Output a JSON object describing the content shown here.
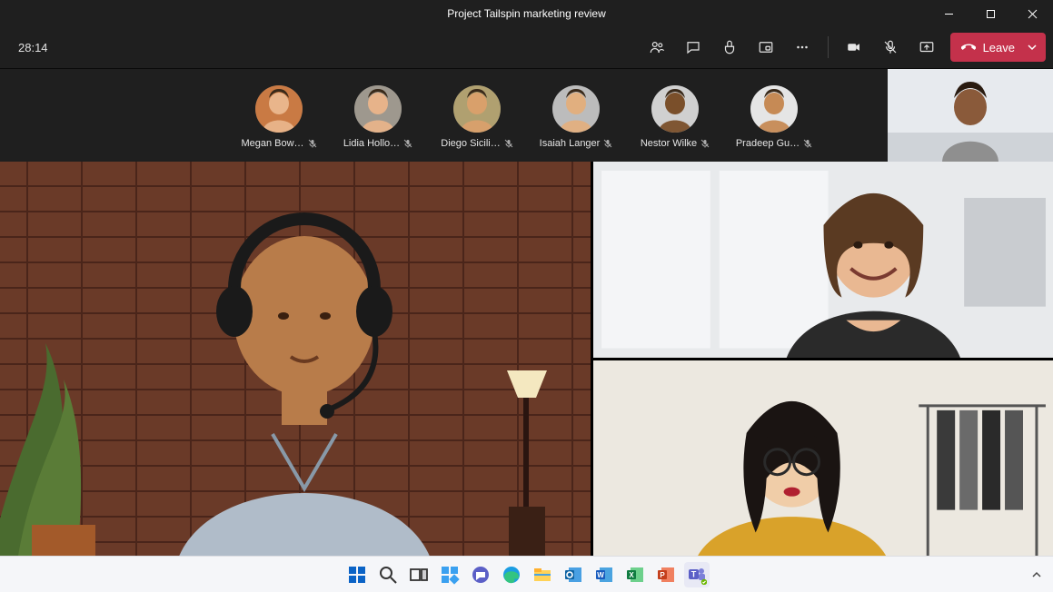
{
  "window": {
    "title": "Project Tailspin marketing review"
  },
  "meeting": {
    "elapsed": "28:14",
    "leave_label": "Leave"
  },
  "roster": {
    "items": [
      {
        "name": "Megan Bow…",
        "muted": true,
        "bg": "#c97a44",
        "skin": "#e9b58b"
      },
      {
        "name": "Lidia Hollo…",
        "muted": true,
        "bg": "#9e988e",
        "skin": "#e7b38a"
      },
      {
        "name": "Diego Sicili…",
        "muted": true,
        "bg": "#b0a070",
        "skin": "#d9a06b"
      },
      {
        "name": "Isaiah Langer",
        "muted": true,
        "bg": "#bcbcbc",
        "skin": "#e1af7f"
      },
      {
        "name": "Nestor Wilke",
        "muted": true,
        "bg": "#d0d0d0",
        "skin": "#7a4f2a"
      },
      {
        "name": "Pradeep Gu…",
        "muted": true,
        "bg": "#e5e5e5",
        "skin": "#c68a55"
      }
    ]
  },
  "taskbar": {
    "icons": [
      "start-icon",
      "search-icon",
      "taskview-icon",
      "widgets-icon",
      "chat-icon",
      "edge-icon",
      "file-explorer-icon",
      "outlook-icon",
      "word-icon",
      "excel-icon",
      "powerpoint-icon",
      "teams-icon"
    ]
  },
  "colors": {
    "leave_red": "#c4314b",
    "teams_purple": "#5b5fc7"
  }
}
